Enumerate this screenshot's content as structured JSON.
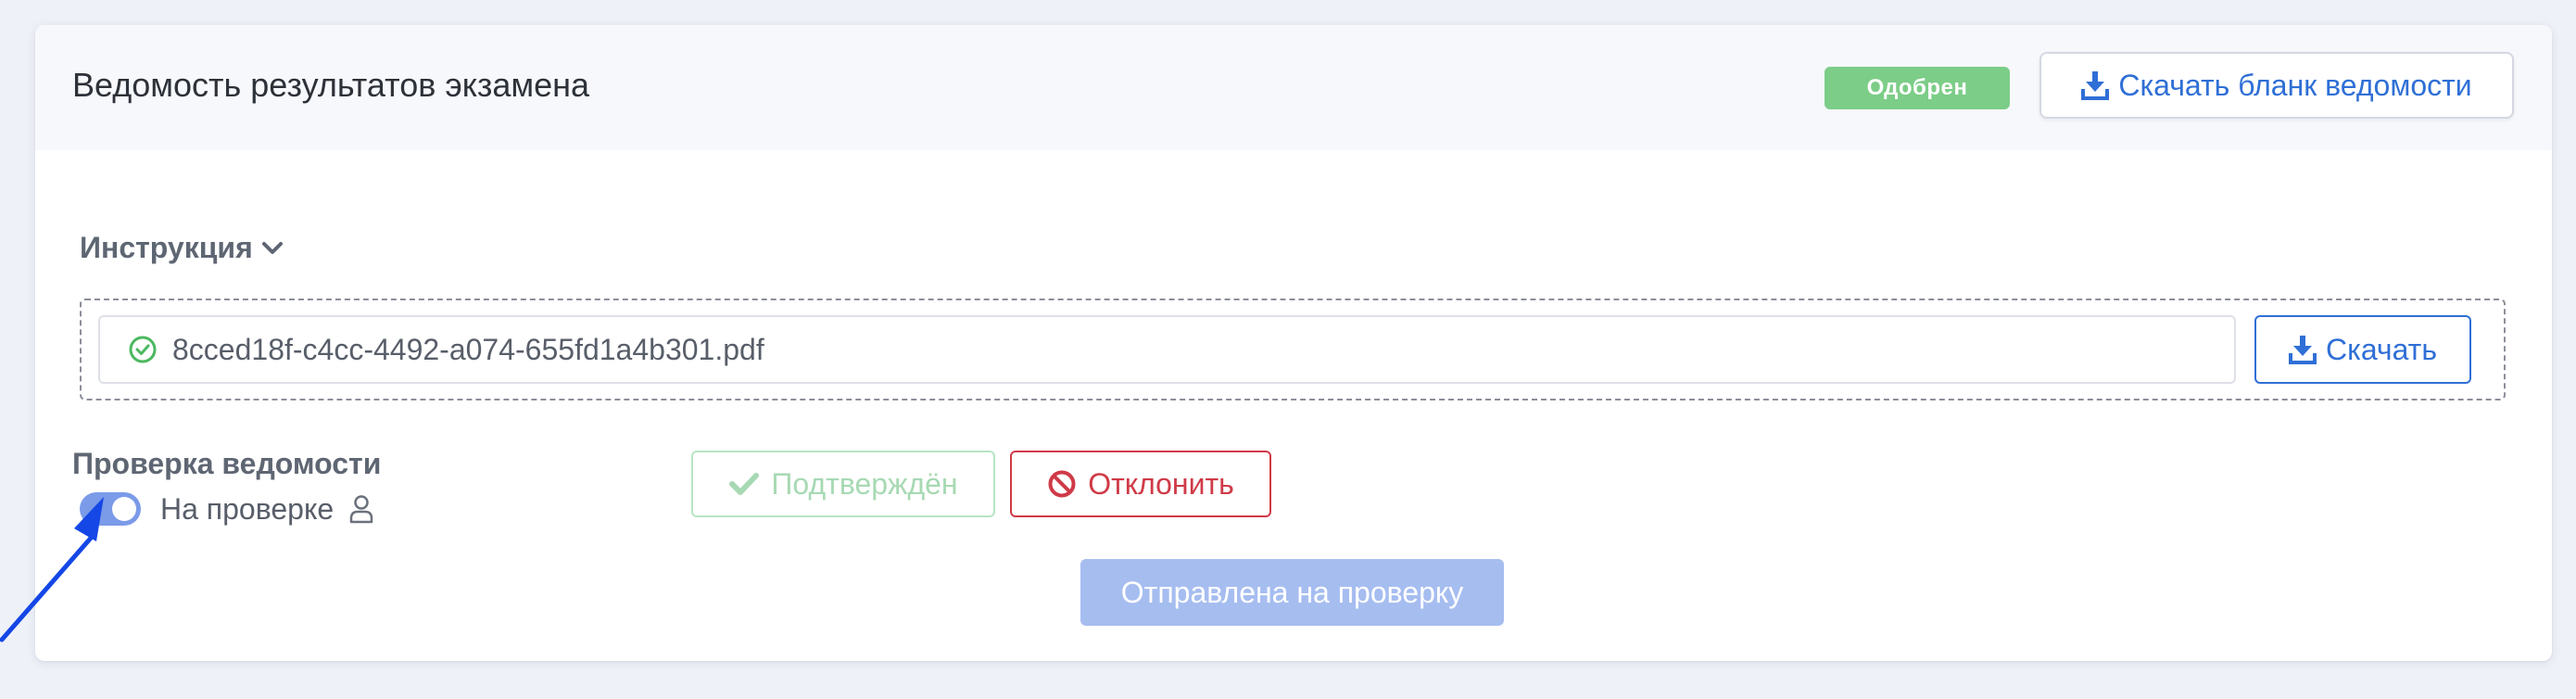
{
  "header": {
    "title": "Ведомость результатов экзамена",
    "status_badge": "Одобрен",
    "download_form_label": "Скачать бланк ведомости"
  },
  "instruction": {
    "label": "Инструкция",
    "file_name": "8cced18f-c4cc-4492-a074-655fd1a4b301.pdf",
    "download_label": "Скачать"
  },
  "review": {
    "label": "Проверка ведомости",
    "toggle_state": "На проверке",
    "toggle_on": true,
    "confirm_label": "Подтверждён",
    "reject_label": "Отклонить",
    "submit_label": "Отправлена на проверку"
  },
  "colors": {
    "accent": "#2f6fd6",
    "success_badge": "#7ccd88",
    "danger": "#cf3a47",
    "submit_disabled": "#a6bdf0",
    "annotation_arrow": "#1447e6"
  }
}
